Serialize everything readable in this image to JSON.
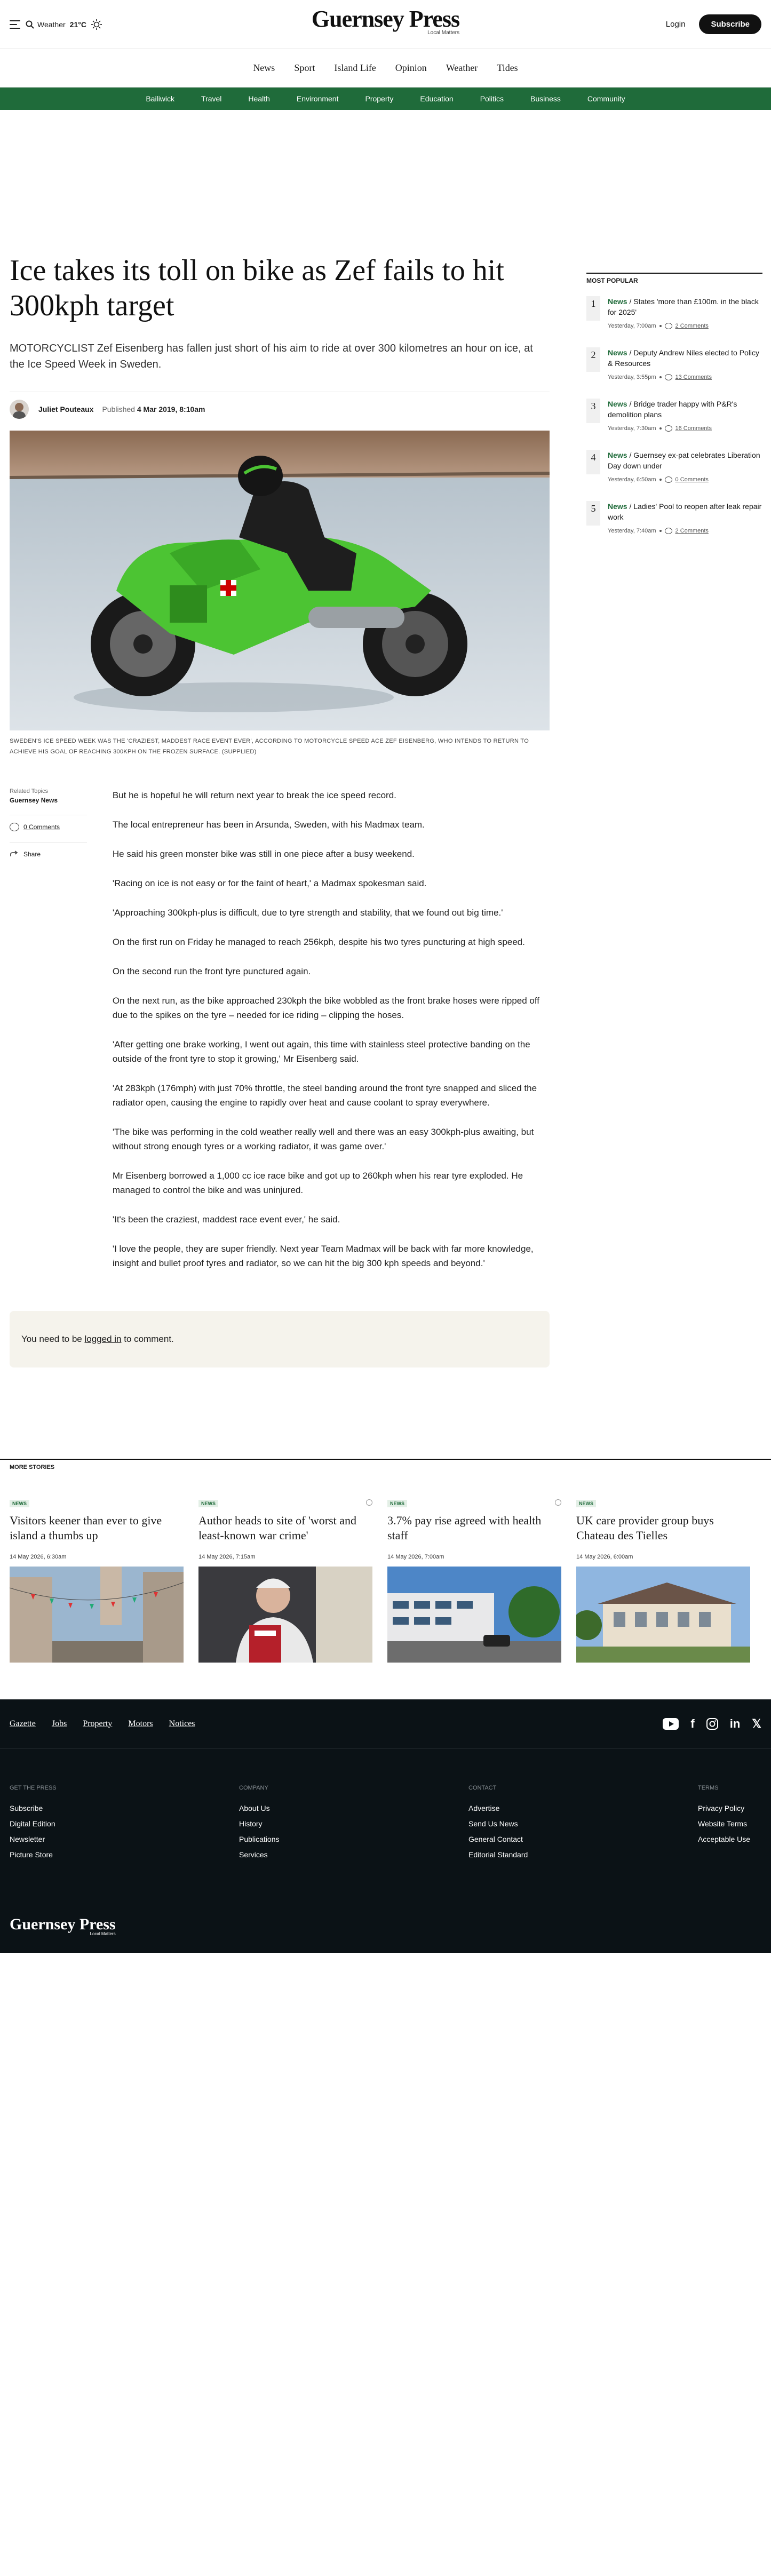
{
  "header": {
    "weather_label": "Weather",
    "weather_temp": "21°C",
    "logo": "Guernsey Press",
    "logo_tag": "Local Matters",
    "login": "Login",
    "subscribe": "Subscribe"
  },
  "main_nav": [
    "News",
    "Sport",
    "Island Life",
    "Opinion",
    "Weather",
    "Tides"
  ],
  "section_nav": [
    "Bailiwick",
    "Travel",
    "Health",
    "Environment",
    "Property",
    "Education",
    "Politics",
    "Business",
    "Community"
  ],
  "article": {
    "title": "Ice takes its toll on bike as Zef fails to hit 300kph target",
    "standfirst": "MOTORCYCLIST Zef Eisenberg has fallen just short of his aim to ride at over 300 kilometres an hour on ice, at the Ice Speed Week in Sweden.",
    "author": "Juliet Pouteaux",
    "published_label": "Published",
    "published_date": "4 Mar 2019, 8:10am",
    "caption": "SWEDEN'S ICE SPEED WEEK WAS THE 'CRAZIEST, MADDEST RACE EVENT EVER', ACCORDING TO MOTORCYCLE SPEED ACE ZEF EISENBERG, WHO INTENDS TO RETURN TO ACHIEVE HIS GOAL OF REACHING 300KPH ON THE FROZEN SURFACE. (SUPPLIED)",
    "related_topics_label": "Related Topics",
    "related_topic": "Guernsey News",
    "comments_label": "0 Comments",
    "share_label": "Share",
    "paragraphs": [
      "But he is hopeful he will return next year to break the ice speed record.",
      "The local entrepreneur has been in Arsunda, Sweden, with his Madmax team.",
      "He said his green monster bike was still in one piece after a busy weekend.",
      "'Racing on ice is not easy or for the faint of heart,' a Madmax spokesman said.",
      "'Approaching 300kph-plus is difficult, due to tyre strength and stability, that we found out big time.'",
      "On the first run on Friday he managed to reach 256kph, despite his two tyres puncturing at high speed.",
      "On the second run the front tyre punctured again.",
      "On the next run, as the bike approached 230kph the bike wobbled as the front brake hoses were ripped off due to the spikes on the tyre – needed for ice riding – clipping the hoses.",
      "'After getting one brake working, I went out again, this time with stainless steel protective banding on the outside of the front tyre to stop it growing,' Mr Eisenberg said.",
      "'At 283kph (176mph) with just 70% throttle, the steel banding around the front tyre snapped and sliced the radiator open, causing the engine to rapidly over heat and cause coolant to spray everywhere.",
      "'The bike was performing in the cold weather really well and there was an easy 300kph-plus awaiting, but without strong enough tyres or a working radiator, it was game over.'",
      "Mr Eisenberg borrowed a 1,000 cc ice race bike and got up to 260kph when his rear tyre exploded. He managed to control the bike and was uninjured.",
      "'It's been the craziest, maddest race event ever,' he said.",
      "'I love the people, they are super friendly. Next year Team Madmax will be back with far more knowledge, insight and bullet proof tyres and radiator, so we can hit the big 300 kph speeds and beyond.'"
    ],
    "comment_prompt_pre": "You need to be",
    "comment_prompt_link": "logged in",
    "comment_prompt_post": "to comment."
  },
  "sidebar": {
    "heading": "MOST POPULAR",
    "items": [
      {
        "num": "1",
        "cat": "News",
        "sep": " / ",
        "text": "States 'more than £100m. in the black for 2025'",
        "time": "Yesterday, 7:00am",
        "comments": "2 Comments"
      },
      {
        "num": "2",
        "cat": "News",
        "sep": " / ",
        "text": "Deputy Andrew Niles elected to Policy & Resources",
        "time": "Yesterday, 3:55pm",
        "comments": "13 Comments"
      },
      {
        "num": "3",
        "cat": "News",
        "sep": " / ",
        "text": "Bridge trader happy with P&R's demolition plans",
        "time": "Yesterday, 7:30am",
        "comments": "16 Comments"
      },
      {
        "num": "4",
        "cat": "News",
        "sep": " / ",
        "text": "Guernsey ex-pat celebrates Liberation Day down under",
        "time": "Yesterday, 6:50am",
        "comments": "0 Comments"
      },
      {
        "num": "5",
        "cat": "News",
        "sep": " / ",
        "text": "Ladies' Pool to reopen after leak repair work",
        "time": "Yesterday, 7:40am",
        "comments": "2 Comments"
      }
    ]
  },
  "more_stories": {
    "heading": "MORE STORIES",
    "cards": [
      {
        "badge": "NEWS",
        "title": "Visitors keener than ever to give island a thumbs up",
        "date": "14 May 2026, 6:30am"
      },
      {
        "badge": "NEWS",
        "title": "Author heads to site of 'worst and least-known war crime'",
        "date": "14 May 2026, 7:15am"
      },
      {
        "badge": "NEWS",
        "title": "3.7% pay rise agreed with health staff",
        "date": "14 May 2026, 7:00am"
      },
      {
        "badge": "NEWS",
        "title": "UK care provider group buys Chateau des Tielles",
        "date": "14 May 2026, 6:00am"
      }
    ]
  },
  "footer": {
    "links": [
      "Gazette",
      "Jobs",
      "Property",
      "Motors",
      "Notices"
    ],
    "socials": [
      "youtube-icon",
      "facebook-icon",
      "instagram-icon",
      "linkedin-icon",
      "x-icon"
    ],
    "columns": [
      {
        "heading": "GET THE PRESS",
        "items": [
          "Subscribe",
          "Digital Edition",
          "Newsletter",
          "Picture Store"
        ]
      },
      {
        "heading": "COMPANY",
        "items": [
          "About Us",
          "History",
          "Publications",
          "Services"
        ]
      },
      {
        "heading": "CONTACT",
        "items": [
          "Advertise",
          "Send Us News",
          "General Contact",
          "Editorial Standard"
        ]
      },
      {
        "heading": "TERMS",
        "items": [
          "Privacy Policy",
          "Website Terms",
          "Acceptable Use"
        ]
      }
    ],
    "logo": "Guernsey Press",
    "logo_tag": "Local Matters"
  },
  "colors": {
    "brand_green": "#1f6b3a",
    "footer_bg": "#0b1216"
  }
}
